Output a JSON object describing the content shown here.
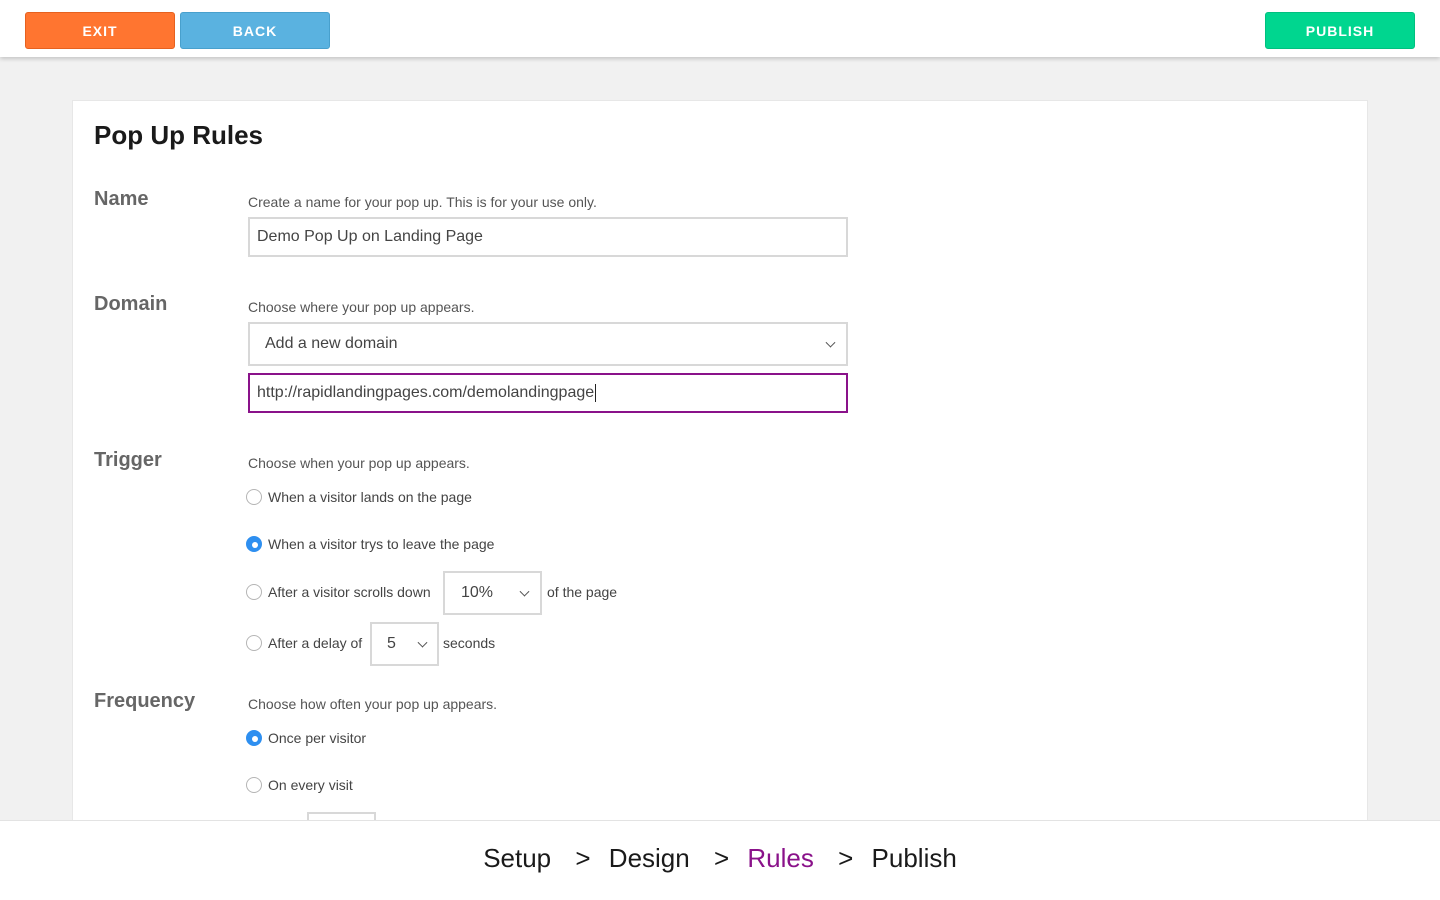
{
  "toolbar": {
    "exit_label": "EXIT",
    "back_label": "BACK",
    "publish_label": "PUBLISH"
  },
  "page_title": "Pop Up Rules",
  "name_section": {
    "label": "Name",
    "hint": "Create a name for your pop up. This is for your use only.",
    "value": "Demo Pop Up on Landing Page"
  },
  "domain_section": {
    "label": "Domain",
    "hint": "Choose where your pop up appears.",
    "select_value": "Add a new domain",
    "url_value": "http://rapidlandingpages.com/demolandingpage"
  },
  "trigger_section": {
    "label": "Trigger",
    "hint": "Choose when your pop up appears.",
    "options": [
      {
        "label": "When a visitor lands on the page",
        "checked": false
      },
      {
        "label": "When a visitor trys to leave the page",
        "checked": true
      },
      {
        "label": "After a visitor scrolls down",
        "checked": false,
        "select_value": "10%",
        "suffix": "of the page"
      },
      {
        "label": "After a delay of",
        "checked": false,
        "select_value": "5",
        "suffix": "seconds"
      }
    ]
  },
  "frequency_section": {
    "label": "Frequency",
    "hint": "Choose how often your pop up appears.",
    "options": [
      {
        "label": "Once per visitor",
        "checked": true
      },
      {
        "label": "On every visit",
        "checked": false
      }
    ]
  },
  "steps": {
    "items": [
      "Setup",
      "Design",
      "Rules",
      "Publish"
    ],
    "separator": ">",
    "active": "Rules",
    "active_color": "#8a128a"
  },
  "colors": {
    "exit": "#ff7530",
    "back": "#5ab2e0",
    "publish": "#00d68f",
    "radio_checked": "#2e8ff0",
    "focus_border": "#8a128a"
  }
}
